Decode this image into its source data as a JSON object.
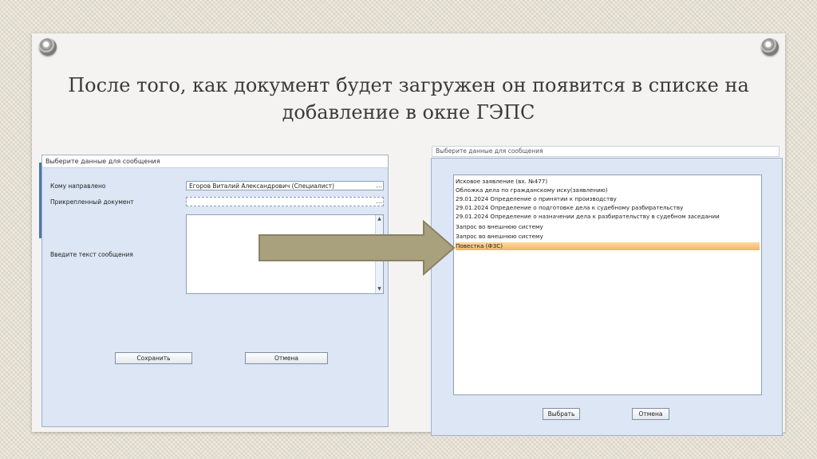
{
  "slide": {
    "title_line1": "После того, как документ будет загружен он появится в списке на",
    "title_line2": "добавление в окне ГЭПС"
  },
  "message_dialog": {
    "header": "Выберите данные для сообщения",
    "recipient_label": "Кому направлено",
    "recipient_value": "Егоров Виталий Александрович (Специалист)",
    "attachment_label": "Прикрепленный документ",
    "attachment_value": "",
    "message_label": "Введите текст сообщения",
    "message_value": "",
    "browse_glyph": "...",
    "save_button": "Сохранить",
    "cancel_button": "Отмена"
  },
  "select_dialog": {
    "header": "Выберите данные для сообщения",
    "items": [
      "Исковое заявление (вх. №477)",
      "Обложка дела по гражданскому иску(заявлению)",
      "29.01.2024 Определение о принятии к производству",
      "29.01.2024 Определение о подготовке дела к судебному разбирательству",
      "29.01.2024 Определение о назначении дела к разбирательству в судебном заседании",
      "Запрос во внешнюю систему",
      "Запрос во внешнюю систему",
      "Повестка (ФЗС)"
    ],
    "selected_index": 7,
    "select_button": "Выбрать",
    "cancel_button": "Отмена"
  },
  "colors": {
    "arrow_fill": "#a9a07e",
    "arrow_stroke": "#8a8262",
    "selection": "#f5b463"
  }
}
